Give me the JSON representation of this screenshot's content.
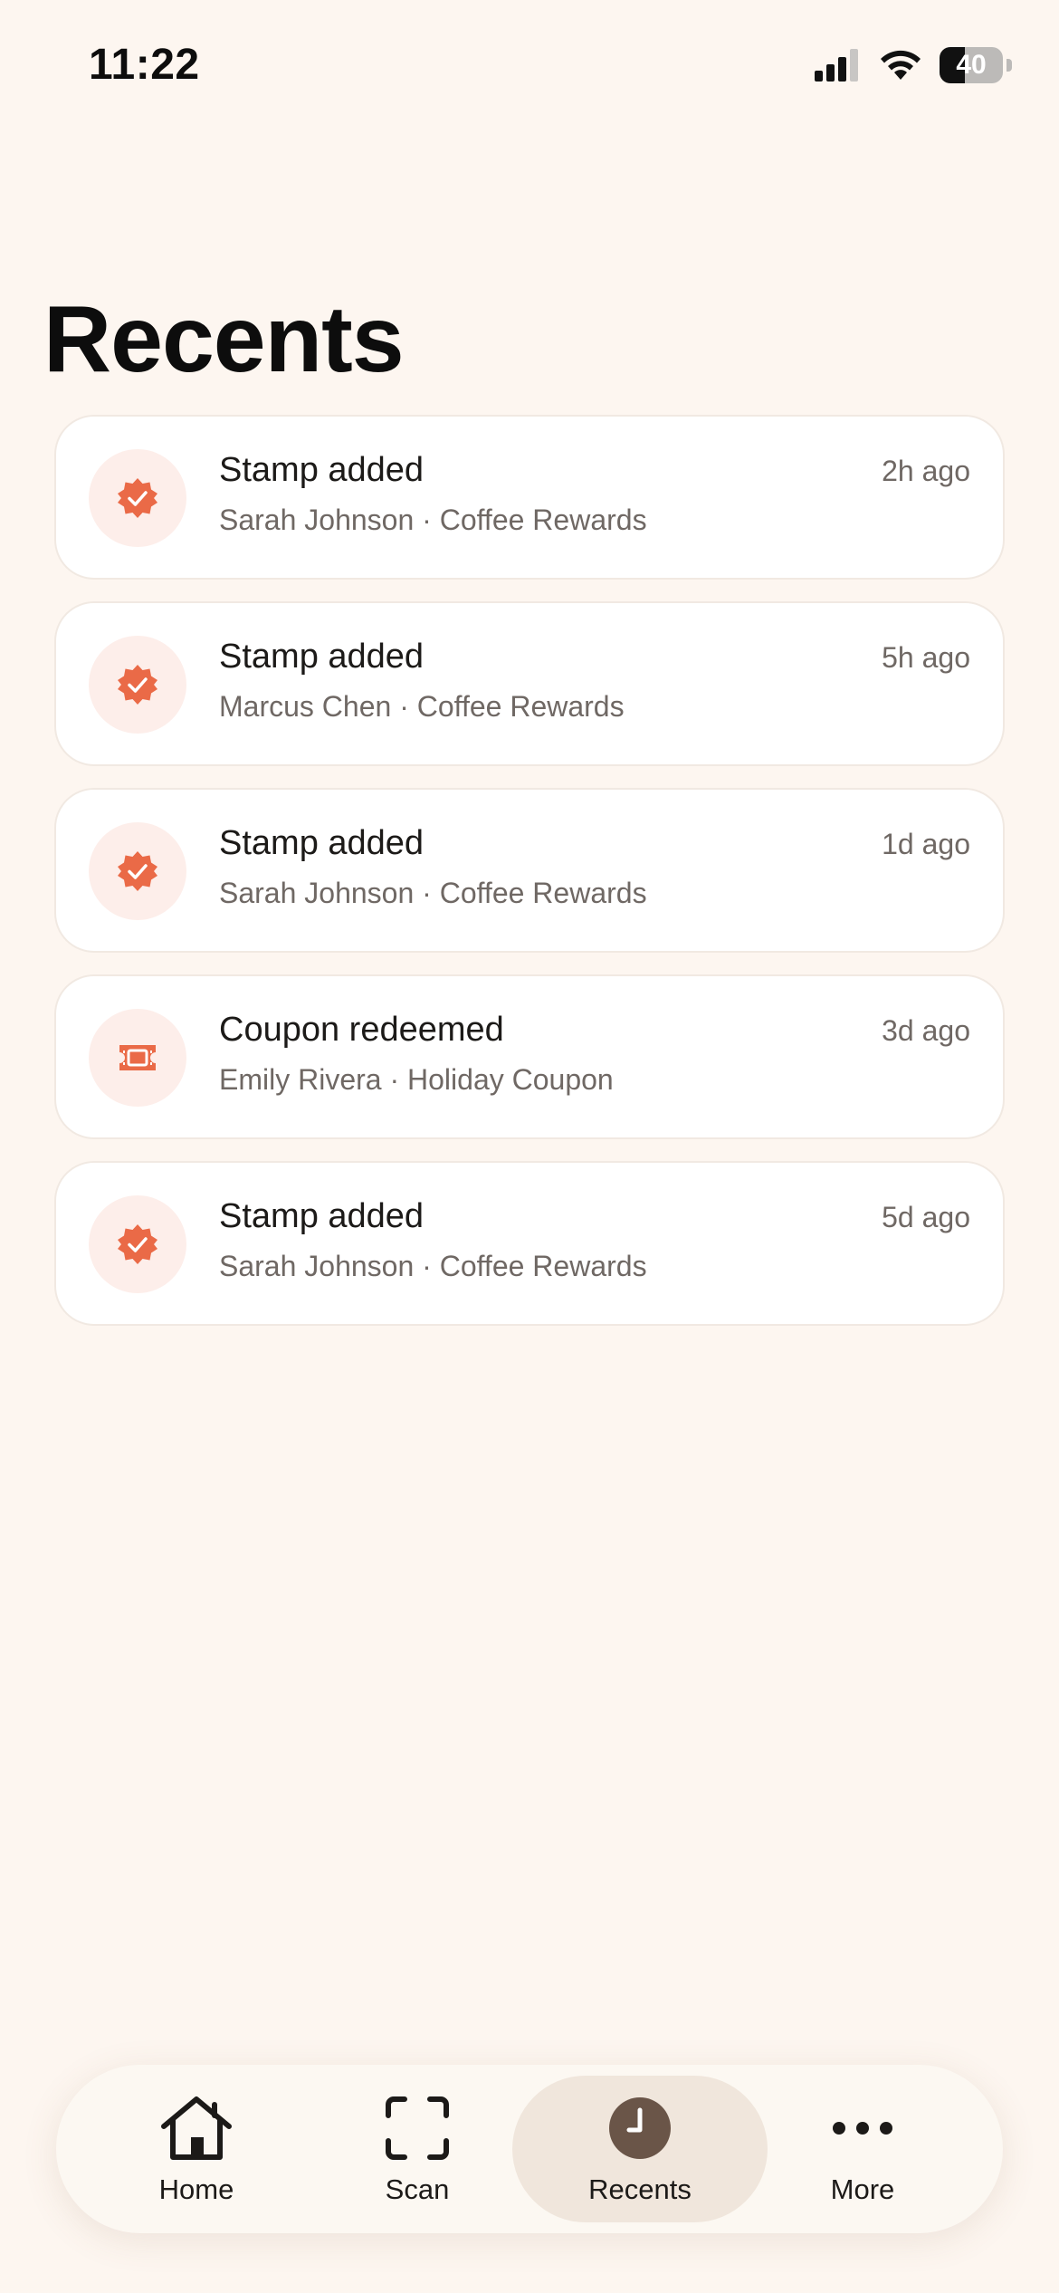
{
  "status_bar": {
    "time": "11:22",
    "battery": "40"
  },
  "page_title": "Recents",
  "activities": [
    {
      "title": "Stamp added",
      "subtitle": "Sarah Johnson · Coffee Rewards",
      "time": "2h ago",
      "icon": "stamp-badge-icon"
    },
    {
      "title": "Stamp added",
      "subtitle": "Marcus Chen · Coffee Rewards",
      "time": "5h ago",
      "icon": "stamp-badge-icon"
    },
    {
      "title": "Stamp added",
      "subtitle": "Sarah Johnson · Coffee Rewards",
      "time": "1d ago",
      "icon": "stamp-badge-icon"
    },
    {
      "title": "Coupon redeemed",
      "subtitle": "Emily Rivera · Holiday Coupon",
      "time": "3d ago",
      "icon": "coupon-ticket-icon"
    },
    {
      "title": "Stamp added",
      "subtitle": "Sarah Johnson · Coffee Rewards",
      "time": "5d ago",
      "icon": "stamp-badge-icon"
    }
  ],
  "tab_bar": {
    "items": [
      {
        "label": "Home",
        "icon": "home-icon"
      },
      {
        "label": "Scan",
        "icon": "scan-icon"
      },
      {
        "label": "Recents",
        "icon": "clock-icon",
        "active": true
      },
      {
        "label": "More",
        "icon": "more-icon"
      }
    ]
  },
  "colors": {
    "accent": "#ea6a47",
    "background": "#fdf6f0",
    "active_tab": "#f0e6dc",
    "clock": "#6a5548"
  }
}
